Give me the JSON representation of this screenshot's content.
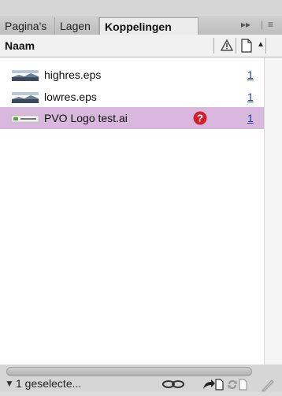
{
  "tabs": [
    "Pagina's",
    "Lagen",
    "Koppelingen"
  ],
  "active_tab": "Koppelingen",
  "tab_controls": {
    "expand": "▸▸",
    "menu": "≡"
  },
  "columns": {
    "name": "Naam"
  },
  "links": [
    {
      "name": "highres.eps",
      "page": "1",
      "status": "",
      "thumb": "landscape"
    },
    {
      "name": "lowres.eps",
      "page": "1",
      "status": "",
      "thumb": "landscape"
    },
    {
      "name": "PVO Logo test.ai",
      "page": "1",
      "status": "missing",
      "thumb": "logo"
    }
  ],
  "selected_row": 2,
  "footer": {
    "status": "1 geselecte..."
  },
  "colors": {
    "selection": "#d8b8dc",
    "missing_icon": "#d0202a",
    "link_number": "#1a40a0"
  }
}
